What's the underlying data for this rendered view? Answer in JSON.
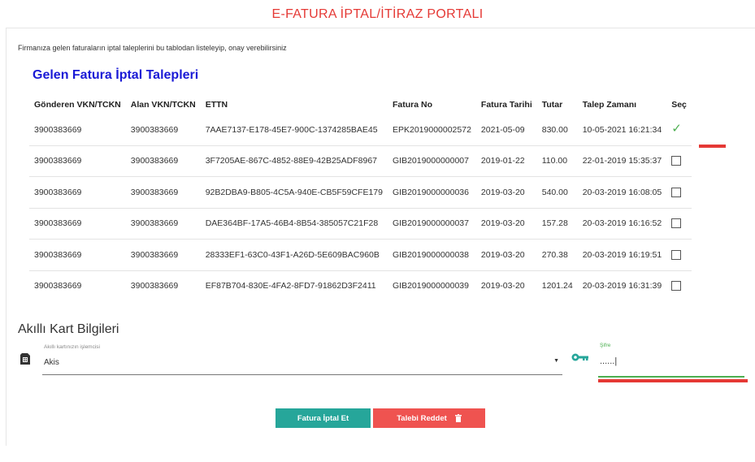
{
  "portal": {
    "title": "E-FATURA İPTAL/İTİRAZ PORTALI",
    "intro": "Firmanıza gelen faturaların iptal taleplerini bu tablodan listeleyip, onay verebilirsiniz"
  },
  "requests": {
    "section_title": "Gelen Fatura İptal Talepleri",
    "columns": [
      "Gönderen VKN/TCKN",
      "Alan VKN/TCKN",
      "ETTN",
      "Fatura No",
      "Fatura Tarihi",
      "Tutar",
      "Talep Zamanı",
      "Seç"
    ],
    "rows": [
      {
        "sender": "3900383669",
        "receiver": "3900383669",
        "ettn": "7AAE7137-E178-45E7-900C-1374285BAE45",
        "invoice_no": "EPK2019000002572",
        "invoice_date": "2021-05-09",
        "amount": "830.00",
        "request_time": "10-05-2021 16:21:34",
        "selected": true
      },
      {
        "sender": "3900383669",
        "receiver": "3900383669",
        "ettn": "3F7205AE-867C-4852-88E9-42B25ADF8967",
        "invoice_no": "GIB2019000000007",
        "invoice_date": "2019-01-22",
        "amount": "110.00",
        "request_time": "22-01-2019 15:35:37",
        "selected": false
      },
      {
        "sender": "3900383669",
        "receiver": "3900383669",
        "ettn": "92B2DBA9-B805-4C5A-940E-CB5F59CFE179",
        "invoice_no": "GIB2019000000036",
        "invoice_date": "2019-03-20",
        "amount": "540.00",
        "request_time": "20-03-2019 16:08:05",
        "selected": false
      },
      {
        "sender": "3900383669",
        "receiver": "3900383669",
        "ettn": "DAE364BF-17A5-46B4-8B54-385057C21F28",
        "invoice_no": "GIB2019000000037",
        "invoice_date": "2019-03-20",
        "amount": "157.28",
        "request_time": "20-03-2019 16:16:52",
        "selected": false
      },
      {
        "sender": "3900383669",
        "receiver": "3900383669",
        "ettn": "28333EF1-63C0-43F1-A26D-5E609BAC960B",
        "invoice_no": "GIB2019000000038",
        "invoice_date": "2019-03-20",
        "amount": "270.38",
        "request_time": "20-03-2019 16:19:51",
        "selected": false
      },
      {
        "sender": "3900383669",
        "receiver": "3900383669",
        "ettn": "EF87B704-830E-4FA2-8FD7-91862D3F2411",
        "invoice_no": "GIB2019000000039",
        "invoice_date": "2019-03-20",
        "amount": "1201.24",
        "request_time": "20-03-2019 16:31:39",
        "selected": false
      }
    ]
  },
  "smart_card": {
    "title": "Akıllı Kart Bilgileri",
    "processor_label": "Akıllı kartınızın işlemcisi",
    "processor_value": "Akis",
    "password_label": "Şifre",
    "password_value": "......|"
  },
  "actions": {
    "cancel_label": "Fatura İptal Et",
    "reject_label": "Talebi Reddet"
  },
  "colors": {
    "title": "#e53935",
    "section_title": "#1a1ad6",
    "accept": "#26a69a",
    "reject": "#ef5350",
    "check": "#4caf50"
  },
  "icons": {
    "selected": "checkmark-icon",
    "unselected": "checkbox-icon",
    "sim": "sim-card-icon",
    "key": "key-icon",
    "trash": "trash-icon"
  }
}
